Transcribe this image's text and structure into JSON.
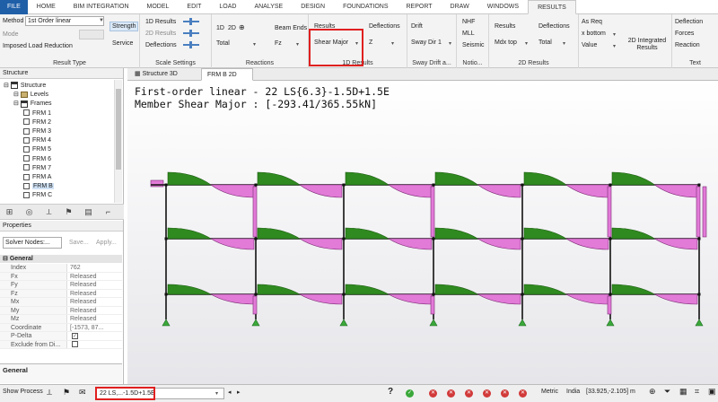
{
  "tabs": [
    "FILE",
    "HOME",
    "BIM INTEGRATION",
    "MODEL",
    "EDIT",
    "LOAD",
    "ANALYSE",
    "DESIGN",
    "FOUNDATIONS",
    "REPORT",
    "DRAW",
    "WINDOWS",
    "RESULTS"
  ],
  "ribbon": {
    "method_label": "Method",
    "method_value": "1st Order linear",
    "mode_label": "Mode",
    "imposed_label": "Imposed Load Reduction",
    "strength": "Strength",
    "service": "Service",
    "result_type": "Result Type",
    "scale_items": [
      "1D Results",
      "2D Results",
      "Deflections"
    ],
    "scale_settings": "Scale Settings",
    "reactions_1d": "1D",
    "reactions_2d": "2D",
    "reactions_total": "Total",
    "beam_ends": "Beam Ends",
    "fz": "Fz",
    "reactions": "Reactions",
    "results_btn": "Results",
    "shear_major": "Shear Major",
    "deflections": "Deflections",
    "z": "Z",
    "results_1d": "1D Results",
    "drift": "Drift",
    "sway_dir": "Sway Dir 1",
    "sway_drift": "Sway Drift a...",
    "nhf": "NHF",
    "mll": "MLL",
    "seismic": "Seismic",
    "notio": "Notio...",
    "results2": "Results",
    "mdx_top": "Mdx top",
    "deflections2": "Deflections",
    "total2": "Total",
    "results_2d": "2D Results",
    "as_req": "As Req",
    "x_bottom": "x bottom",
    "value": "Value",
    "integrated": "2D Integrated Results",
    "deflection": "Deflection",
    "forces": "Forces",
    "reaction": "Reaction",
    "text": "Text"
  },
  "structure": {
    "title": "Structure",
    "items": [
      {
        "label": "Structure",
        "indent": 0
      },
      {
        "label": "Levels",
        "indent": 1
      },
      {
        "label": "Frames",
        "indent": 1
      },
      {
        "label": "FRM 1",
        "indent": 2
      },
      {
        "label": "FRM 2",
        "indent": 2
      },
      {
        "label": "FRM 3",
        "indent": 2
      },
      {
        "label": "FRM 4",
        "indent": 2
      },
      {
        "label": "FRM 5",
        "indent": 2
      },
      {
        "label": "FRM 6",
        "indent": 2
      },
      {
        "label": "FRM 7",
        "indent": 2
      },
      {
        "label": "FRM A",
        "indent": 2
      },
      {
        "label": "FRM B",
        "indent": 2
      },
      {
        "label": "FRM C",
        "indent": 2
      }
    ]
  },
  "properties": {
    "title": "Properties",
    "solver": "Solver Nodes:...",
    "save": "Save...",
    "apply": "Apply...",
    "section": "General",
    "rows": [
      {
        "k": "Index",
        "v": "762"
      },
      {
        "k": "Fx",
        "v": "Released"
      },
      {
        "k": "Fy",
        "v": "Released"
      },
      {
        "k": "Fz",
        "v": "Released"
      },
      {
        "k": "Mx",
        "v": "Released"
      },
      {
        "k": "My",
        "v": "Released"
      },
      {
        "k": "Mz",
        "v": "Released"
      },
      {
        "k": "Coordinate",
        "v": "[-1573, 87..."
      },
      {
        "k": "P-Delta",
        "v": ""
      },
      {
        "k": "Exclude from Di...",
        "v": ""
      }
    ],
    "footer": "General"
  },
  "doc_tabs": [
    "Structure 3D",
    "FRM B 2D"
  ],
  "canvas": {
    "line1": "First-order linear - 22 LS{6.3}-1.5D+1.5E",
    "line2": "Member Shear Major : [-293.41/365.55kN]"
  },
  "status": {
    "show_process": "Show Process",
    "combo": "22 LS,...-1.5D+1.5E",
    "metric": "Metric",
    "region": "India",
    "coords": "[33.925,-2.105] m"
  },
  "colors": {
    "green": "#2f8a1f",
    "magenta": "#e27ad8",
    "highlight": "#e02020",
    "accent": "#1f5fa8"
  }
}
